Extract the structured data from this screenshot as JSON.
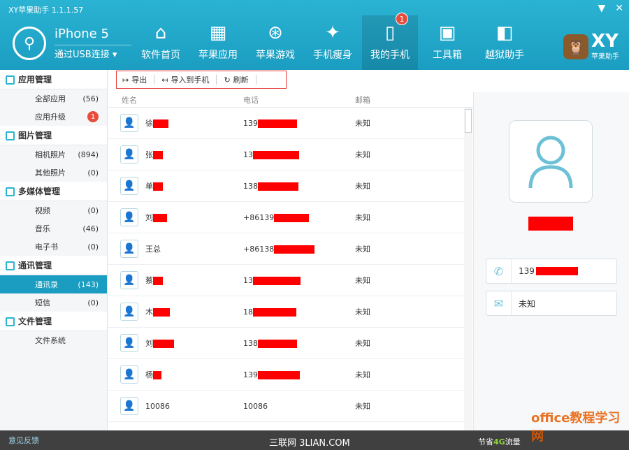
{
  "header": {
    "title": "XY苹果助手 1.1.1.57",
    "device_name": "iPhone 5",
    "device_connection": "通过USB连接 ▾",
    "nav": [
      {
        "label": "软件首页",
        "icon": "⌂"
      },
      {
        "label": "苹果应用",
        "icon": "▦"
      },
      {
        "label": "苹果游戏",
        "icon": "⊛"
      },
      {
        "label": "手机瘦身",
        "icon": "✦"
      },
      {
        "label": "我的手机",
        "icon": "▯",
        "badge": "1",
        "active": true
      },
      {
        "label": "工具箱",
        "icon": "▣"
      },
      {
        "label": "越狱助手",
        "icon": "◧"
      }
    ],
    "brand_text": "XY",
    "brand_sub": "苹果助手",
    "min_icon": "▼",
    "close_icon": "✕"
  },
  "sidebar": {
    "groups": [
      {
        "label": "应用管理",
        "items": [
          {
            "label": "全部应用",
            "count": "(56)"
          },
          {
            "label": "应用升级",
            "badge": "1"
          }
        ]
      },
      {
        "label": "图片管理",
        "items": [
          {
            "label": "相机照片",
            "count": "(894)"
          },
          {
            "label": "其他照片",
            "count": "(0)"
          }
        ]
      },
      {
        "label": "多媒体管理",
        "items": [
          {
            "label": "视频",
            "count": "(0)"
          },
          {
            "label": "音乐",
            "count": "(46)"
          },
          {
            "label": "电子书",
            "count": "(0)"
          }
        ]
      },
      {
        "label": "通讯管理",
        "items": [
          {
            "label": "通讯录",
            "count": "(143)",
            "active": true
          },
          {
            "label": "短信",
            "count": "(0)"
          }
        ]
      },
      {
        "label": "文件管理",
        "items": [
          {
            "label": "文件系统",
            "count": ""
          }
        ]
      }
    ]
  },
  "toolbar": {
    "export_label": "导出",
    "import_label": "导入到手机",
    "refresh_label": "刷新"
  },
  "list": {
    "columns": [
      "姓名",
      "电话",
      "邮箱"
    ],
    "rows": [
      {
        "name": "徐",
        "phone": "139",
        "mail": "未知"
      },
      {
        "name": "张",
        "phone": "13",
        "mail": "未知"
      },
      {
        "name": "单",
        "phone": "138",
        "mail": "未知"
      },
      {
        "name": "刘",
        "phone": "+86139",
        "mail": "未知"
      },
      {
        "name": "王总",
        "phone": "+86138",
        "mail": "未知"
      },
      {
        "name": "蔡",
        "phone": "13",
        "mail": "未知"
      },
      {
        "name": "木",
        "phone": "18",
        "mail": "未知"
      },
      {
        "name": "刘",
        "phone": "138",
        "mail": "未知"
      },
      {
        "name": "杨",
        "phone": "139",
        "mail": "未知"
      },
      {
        "name": "10086",
        "phone": "10086",
        "mail": "未知"
      }
    ]
  },
  "detail": {
    "phone": "139",
    "email": "未知"
  },
  "status": {
    "feedback": "意见反馈",
    "center": "三联网 3LIAN.COM",
    "saver_prefix": "节省",
    "saver_highlight": "4G",
    "saver_suffix": "流量",
    "watermark": "office教程学习网"
  }
}
